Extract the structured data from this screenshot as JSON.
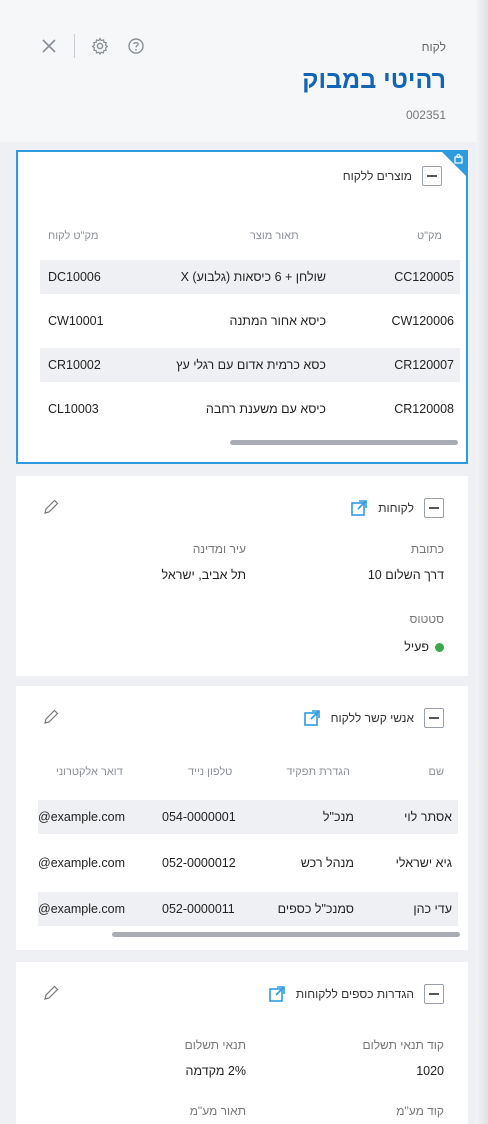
{
  "header": {
    "record_type": "לקוח",
    "title": "רהיטי במבוק",
    "record_id": "002351"
  },
  "products_card": {
    "title": "מוצרים ללקוח",
    "columns": [
      "מק\"ט",
      "תאור מוצר",
      "מק\"ט לקוח"
    ],
    "rows": [
      {
        "sku": "CC120005",
        "desc": "שולחן + 6 כיסאות (גלבוע) X",
        "customer_sku": "DC10006"
      },
      {
        "sku": "CW120006",
        "desc": "כיסא אחור המתנה",
        "customer_sku": "CW10001"
      },
      {
        "sku": "CR120007",
        "desc": "כסא כרמית אדום עם רגלי עץ",
        "customer_sku": "CR10002"
      },
      {
        "sku": "CR120008",
        "desc": "כיסא עם משענת רחבה",
        "customer_sku": "CL10003"
      }
    ]
  },
  "customers_card": {
    "title": "לקוחות",
    "address_label": "כתובת",
    "address_value": "דרך השלום 10",
    "city_label": "עיר ומדינה",
    "city_value": "תל אביב, ישראל",
    "status_label": "סטטוס",
    "status_value": "פעיל",
    "status_color": "#3aa84a"
  },
  "contacts_card": {
    "title": "אנשי קשר ללקוח",
    "columns": [
      "שם",
      "הגדרת תפקיד",
      "טלפון נייד",
      "דואר אלקטרוני"
    ],
    "rows": [
      {
        "name": "אסתר לוי",
        "role": "מנכ\"ל",
        "phone": "054-0000001",
        "email": "@example.com"
      },
      {
        "name": "גיא ישראלי",
        "role": "מנהל רכש",
        "phone": "052-0000012",
        "email": "@example.com"
      },
      {
        "name": "עדי כהן",
        "role": "סמנכ\"ל כספים",
        "phone": "052-0000011",
        "email": "@example.com"
      }
    ]
  },
  "finance_card": {
    "title": "הגדרות כספים ללקוחות",
    "payment_code_label": "קוד תנאי תשלום",
    "payment_code_value": "1020",
    "payment_terms_label": "תנאי תשלום",
    "payment_terms_value": "2% מקדמה",
    "vat_code_label": "קוד מע\"מ",
    "vat_desc_label": "תאור מע\"מ"
  },
  "colors": {
    "accent": "#1464b4",
    "selection": "#2e9be0"
  }
}
